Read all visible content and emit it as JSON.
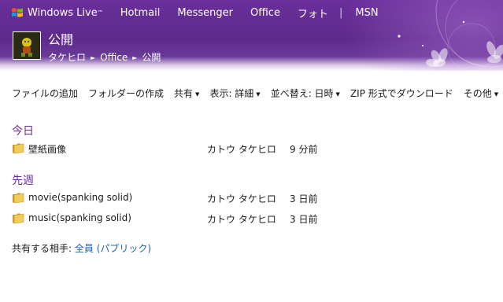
{
  "topnav": {
    "brand": "Windows Live",
    "brand_tm": "™",
    "links": [
      "Hotmail",
      "Messenger",
      "Office",
      "フォト"
    ],
    "separator": "|",
    "msn": "MSN"
  },
  "folder": {
    "title": "公開",
    "breadcrumb": [
      "タケヒロ",
      "Office",
      "公開"
    ],
    "breadcrumb_arrow": "►"
  },
  "toolbar": {
    "add_files": "ファイルの追加",
    "new_folder": "フォルダーの作成",
    "share": "共有",
    "view": "表示: 詳細",
    "sort": "並べ替え: 日時",
    "zip": "ZIP 形式でダウンロード",
    "more": "その他",
    "caret": "▼"
  },
  "sections": [
    {
      "title": "今日",
      "items": [
        {
          "name": "壁紙画像",
          "owner": "カトウ タケヒロ",
          "time": "9 分前"
        }
      ]
    },
    {
      "title": "先週",
      "items": [
        {
          "name": "movie(spanking solid)",
          "owner": "カトウ タケヒロ",
          "time": "3 日前"
        },
        {
          "name": "music(spanking solid)",
          "owner": "カトウ タケヒロ",
          "time": "3 日前"
        }
      ]
    }
  ],
  "sharing": {
    "label": "共有する相手:",
    "value": "全員 (パブリック)"
  },
  "colors": {
    "header_purple": "#5d2a8c",
    "section_title": "#6a2f9a",
    "link": "#1a5fae",
    "folder_yellow": "#e8c04a"
  }
}
